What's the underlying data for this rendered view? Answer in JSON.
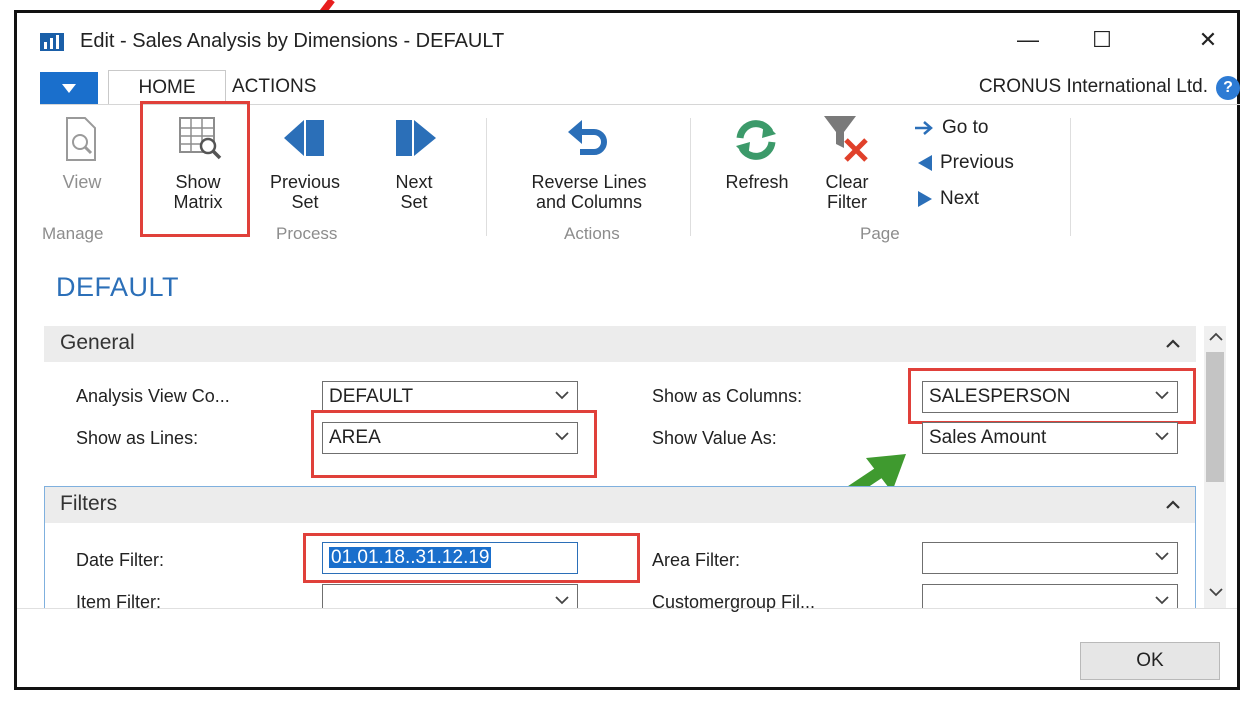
{
  "window": {
    "title": "Edit - Sales Analysis by Dimensions - DEFAULT",
    "minimize_glyph": "—",
    "maximize_glyph": "☐",
    "close_glyph": "✕"
  },
  "tabs": {
    "home": "HOME",
    "actions": "ACTIONS"
  },
  "company": "CRONUS International Ltd.",
  "help_glyph": "?",
  "ribbon": {
    "view": "View",
    "show_matrix": [
      "Show",
      "Matrix"
    ],
    "previous_set": [
      "Previous",
      "Set"
    ],
    "next_set": [
      "Next",
      "Set"
    ],
    "reverse": [
      "Reverse Lines",
      "and Columns"
    ],
    "refresh": "Refresh",
    "clear_filter": [
      "Clear",
      "Filter"
    ],
    "go_to": "Go to",
    "previous": "Previous",
    "next": "Next",
    "groups": {
      "manage": "Manage",
      "process": "Process",
      "actions": "Actions",
      "page": "Page"
    }
  },
  "page_title": "DEFAULT",
  "general": {
    "header": "General",
    "analysis_view_label": "Analysis View Co...",
    "analysis_view_value": "DEFAULT",
    "show_as_lines_label": "Show as Lines:",
    "show_as_lines_value": "AREA",
    "show_as_columns_label": "Show as Columns:",
    "show_as_columns_value": "SALESPERSON",
    "show_value_as_label": "Show Value As:",
    "show_value_as_value": "Sales Amount"
  },
  "filters": {
    "header": "Filters",
    "date_filter_label": "Date Filter:",
    "date_filter_value": "01.01.18..31.12.19",
    "item_filter_label": "Item Filter:",
    "item_filter_value": "",
    "area_filter_label": "Area Filter:",
    "area_filter_value": "",
    "customergroup_filter_label": "Customergroup Fil...",
    "customergroup_filter_value": ""
  },
  "ok_label": "OK",
  "colors": {
    "accent": "#1a6fcc",
    "title_blue": "#2b6fb8",
    "highlight_red": "#e0403a",
    "annotation_green": "#3f9a2f",
    "refresh_green": "#3c9a6a"
  }
}
